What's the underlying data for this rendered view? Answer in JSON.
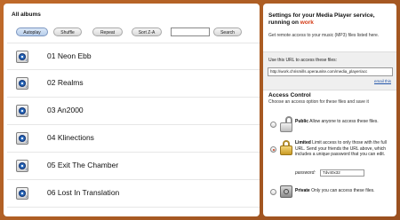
{
  "albums_panel": {
    "title": "All albums",
    "controls": {
      "autoplay": "Autoplay",
      "shuffle": "Shuffle",
      "repeat": "Repeat",
      "sort": "Sort Z-A",
      "search_value": "",
      "search_button": "Search"
    },
    "tracks": [
      {
        "name": "01 Neon Ebb",
        "icon": "music-file-icon"
      },
      {
        "name": "02 Realms",
        "icon": "music-file-icon"
      },
      {
        "name": "03 An2000",
        "icon": "music-file-icon"
      },
      {
        "name": "04 Klinections",
        "icon": "music-file-icon"
      },
      {
        "name": "05 Exit The Chamber",
        "icon": "music-file-icon"
      },
      {
        "name": "06 Lost In Translation",
        "icon": "music-file-icon"
      }
    ]
  },
  "settings_panel": {
    "title_prefix": "Settings for your Media Player service, running on ",
    "title_brand": "work",
    "subtitle": "Get remote access to your music (MP3) files listed here.",
    "url_label": "Use this URL to access these files:",
    "url_value": "http://work.chrismills.operaunite.com/media_player/acc",
    "email_link": "email this",
    "access_control": {
      "title": "Access Control",
      "subtitle": "Choose an access option for these files and save it",
      "options": [
        {
          "name": "Public",
          "text": "Allow anyone to access these files.",
          "selected": false,
          "icon": "open-lock-icon"
        },
        {
          "name": "Limited",
          "text": "Limit access to only those with the full URL. Send your friends the URL above, which includes a unique password that you can edit.",
          "selected": true,
          "icon": "gold-lock-icon"
        },
        {
          "name": "Private",
          "text": "Only you can access these files.",
          "selected": false,
          "icon": "vault-icon"
        }
      ],
      "password_label": "password:",
      "password_value": "Tdv40x32"
    }
  },
  "colors": {
    "background": "#b5612a",
    "brand_red": "#d43a14",
    "link_blue": "#2255aa"
  }
}
